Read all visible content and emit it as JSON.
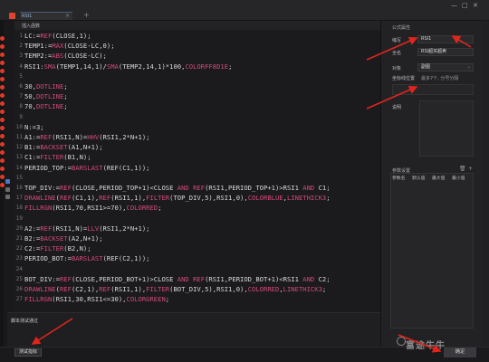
{
  "titlebar": {
    "tab_label": "RSI1",
    "tab_close": "×",
    "tab_add": "+",
    "window_controls": [
      "—",
      "□",
      "✕"
    ]
  },
  "editor": {
    "insert_function_label": "插入函数",
    "lines": [
      {
        "n": "1",
        "tokens": [
          [
            "id",
            "LC:="
          ],
          [
            "fn",
            "REF"
          ],
          [
            "id",
            "(CLOSE,1);"
          ]
        ]
      },
      {
        "n": "2",
        "tokens": [
          [
            "id",
            "TEMP1:="
          ],
          [
            "fn",
            "MAX"
          ],
          [
            "id",
            "(CLOSE-LC,0);"
          ]
        ]
      },
      {
        "n": "3",
        "tokens": [
          [
            "id",
            "TEMP2:="
          ],
          [
            "fn",
            "ABS"
          ],
          [
            "id",
            "(CLOSE-LC);"
          ]
        ]
      },
      {
        "n": "4",
        "tokens": [
          [
            "id",
            "RSI1:"
          ],
          [
            "fn",
            "SMA"
          ],
          [
            "id",
            "(TEMP1,14,1)/"
          ],
          [
            "fn",
            "SMA"
          ],
          [
            "id",
            "(TEMP2,14,1)*100,"
          ],
          [
            "kw",
            "COLORFF8D1E"
          ],
          [
            "id",
            ";"
          ]
        ]
      },
      {
        "n": "5",
        "tokens": []
      },
      {
        "n": "6",
        "tokens": [
          [
            "id",
            "30,"
          ],
          [
            "kw",
            "DOTLINE"
          ],
          [
            "id",
            ";"
          ]
        ]
      },
      {
        "n": "7",
        "tokens": [
          [
            "id",
            "50,"
          ],
          [
            "kw",
            "DOTLINE"
          ],
          [
            "id",
            ";"
          ]
        ]
      },
      {
        "n": "8",
        "tokens": [
          [
            "id",
            "70,"
          ],
          [
            "kw",
            "DOTLINE"
          ],
          [
            "id",
            ";"
          ]
        ]
      },
      {
        "n": "9",
        "tokens": []
      },
      {
        "n": "10",
        "tokens": [
          [
            "id",
            "N:=3;"
          ]
        ]
      },
      {
        "n": "11",
        "tokens": [
          [
            "id",
            "A1:="
          ],
          [
            "fn",
            "REF"
          ],
          [
            "id",
            "(RSI1,N)="
          ],
          [
            "fn",
            "HHV"
          ],
          [
            "id",
            "(RSI1,2*N+1);"
          ]
        ]
      },
      {
        "n": "12",
        "tokens": [
          [
            "id",
            "B1:="
          ],
          [
            "fn",
            "BACKSET"
          ],
          [
            "id",
            "(A1,N+1);"
          ]
        ]
      },
      {
        "n": "13",
        "tokens": [
          [
            "id",
            "C1:="
          ],
          [
            "fn",
            "FILTER"
          ],
          [
            "id",
            "(B1,N);"
          ]
        ]
      },
      {
        "n": "14",
        "tokens": [
          [
            "id",
            "PERIOD_TOP:="
          ],
          [
            "fn",
            "BARSLAST"
          ],
          [
            "id",
            "(REF(C1,1));"
          ]
        ]
      },
      {
        "n": "15",
        "tokens": []
      },
      {
        "n": "16",
        "tokens": [
          [
            "id",
            "TOP_DIV:="
          ],
          [
            "fn",
            "REF"
          ],
          [
            "id",
            "(CLOSE,PERIOD_TOP+1)<CLOSE "
          ],
          [
            "kw",
            "AND"
          ],
          [
            "id",
            " "
          ],
          [
            "fn",
            "REF"
          ],
          [
            "id",
            "(RSI1,PERIOD_TOP+1)>RSI1 "
          ],
          [
            "kw",
            "AND"
          ],
          [
            "id",
            " C1;"
          ]
        ]
      },
      {
        "n": "17",
        "tokens": [
          [
            "fn",
            "DRAWLINE"
          ],
          [
            "id",
            "("
          ],
          [
            "fn",
            "REF"
          ],
          [
            "id",
            "(C1,1),"
          ],
          [
            "fn",
            "REF"
          ],
          [
            "id",
            "(RSI1,1),"
          ],
          [
            "fn",
            "FILTER"
          ],
          [
            "id",
            "(TOP_DIV,5),RSI1,0),"
          ],
          [
            "kw",
            "COLORBLUE"
          ],
          [
            "id",
            ","
          ],
          [
            "kw",
            "LINETHICK3"
          ],
          [
            "id",
            ";"
          ]
        ]
      },
      {
        "n": "18",
        "tokens": [
          [
            "fn",
            "FILLRGN"
          ],
          [
            "id",
            "(RSI1,70,RSI1>=70),"
          ],
          [
            "kw",
            "COLORRED"
          ],
          [
            "id",
            ";"
          ]
        ]
      },
      {
        "n": "19",
        "tokens": []
      },
      {
        "n": "20",
        "tokens": [
          [
            "id",
            "A2:="
          ],
          [
            "fn",
            "REF"
          ],
          [
            "id",
            "(RSI1,N)="
          ],
          [
            "fn",
            "LLV"
          ],
          [
            "id",
            "(RSI1,2*N+1);"
          ]
        ]
      },
      {
        "n": "21",
        "tokens": [
          [
            "id",
            "B2:="
          ],
          [
            "fn",
            "BACKSET"
          ],
          [
            "id",
            "(A2,N+1);"
          ]
        ]
      },
      {
        "n": "22",
        "tokens": [
          [
            "id",
            "C2:="
          ],
          [
            "fn",
            "FILTER"
          ],
          [
            "id",
            "(B2,N);"
          ]
        ]
      },
      {
        "n": "23",
        "tokens": [
          [
            "id",
            "PERIOD_BOT:="
          ],
          [
            "fn",
            "BARSLAST"
          ],
          [
            "id",
            "(REF(C2,1));"
          ]
        ]
      },
      {
        "n": "24",
        "tokens": []
      },
      {
        "n": "25",
        "tokens": [
          [
            "id",
            "BOT_DIV:="
          ],
          [
            "fn",
            "REF"
          ],
          [
            "id",
            "(CLOSE,PERIOD_BOT+1)>CLOSE "
          ],
          [
            "kw",
            "AND"
          ],
          [
            "id",
            " "
          ],
          [
            "fn",
            "REF"
          ],
          [
            "id",
            "(RSI1,PERIOD_BOT+1)<RSI1 "
          ],
          [
            "kw",
            "AND"
          ],
          [
            "id",
            " C2;"
          ]
        ]
      },
      {
        "n": "26",
        "tokens": [
          [
            "fn",
            "DRAWLINE"
          ],
          [
            "id",
            "("
          ],
          [
            "fn",
            "REF"
          ],
          [
            "id",
            "(C2,1),"
          ],
          [
            "fn",
            "REF"
          ],
          [
            "id",
            "(RSI1,1),"
          ],
          [
            "fn",
            "FILTER"
          ],
          [
            "id",
            "(BOT_DIV,5),RSI1,0),"
          ],
          [
            "kw",
            "COLORRED"
          ],
          [
            "id",
            ","
          ],
          [
            "kw",
            "LINETHICK3"
          ],
          [
            "id",
            ";"
          ]
        ]
      },
      {
        "n": "27",
        "tokens": [
          [
            "fn",
            "FILLRGN"
          ],
          [
            "id",
            "(RSI1,30,RSI1<=30),"
          ],
          [
            "kw",
            "COLORGREEN"
          ],
          [
            "id",
            ";"
          ]
        ]
      }
    ],
    "test_message_label": "脚本测试通过"
  },
  "right_panel": {
    "formula_attr_title": "公式属性",
    "abbr_label": "缩写",
    "abbr_value": "RSI1",
    "fullname_label": "全名",
    "fullname_value": "RSI超买超卖",
    "target_label": "对象",
    "target_value": "副图",
    "coord_checkbox_label": "坐标线位置",
    "coord_hint": "最多7个, 分号分隔",
    "desc_label": "说明",
    "params_title": "参数设置",
    "params_headers": [
      "参数名",
      "默认值",
      "最大值",
      "最小值"
    ]
  },
  "bottom": {
    "test_button": "测试指标",
    "ok_button": "确定"
  },
  "watermark": "富途牛牛",
  "colors": {
    "keyword": "#d24a78",
    "identifier": "#d8d8d8",
    "annotation_red": "#e0251c"
  }
}
